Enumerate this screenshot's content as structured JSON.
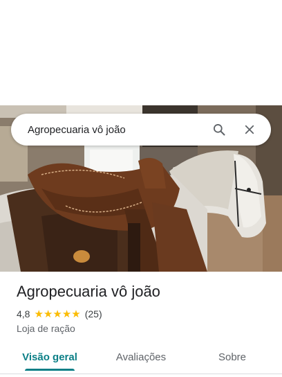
{
  "search": {
    "query": "Agropecuaria vô joão",
    "search_icon": "search-icon",
    "close_icon": "close-icon"
  },
  "place": {
    "name": "Agropecuaria vô joão",
    "rating": "4,8",
    "stars": 5,
    "reviews_count": "(25)",
    "category": "Loja de ração"
  },
  "tabs": [
    {
      "label": "Visão geral",
      "active": true
    },
    {
      "label": "Avaliações",
      "active": false
    },
    {
      "label": "Sobre",
      "active": false
    }
  ],
  "colors": {
    "accent": "#0b7f86",
    "star": "#fbbc04"
  }
}
